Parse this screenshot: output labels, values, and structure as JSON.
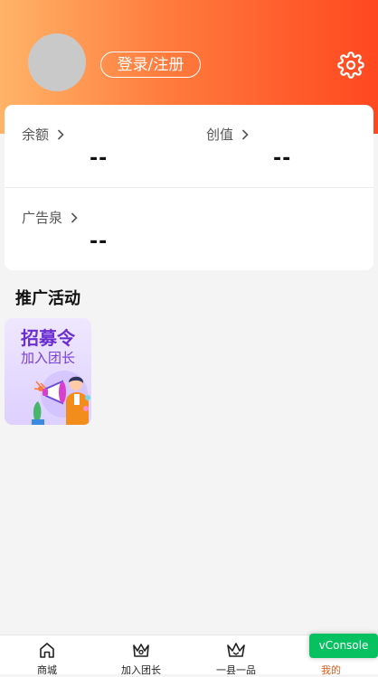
{
  "profile": {
    "login_label": "登录/注册"
  },
  "stats": {
    "balance": {
      "label": "余额",
      "value": "--"
    },
    "creation": {
      "label": "创值",
      "value": "--"
    },
    "ad_voucher": {
      "label": "广告泉",
      "value": "--"
    }
  },
  "promotions": {
    "title": "推广活动",
    "banner": {
      "line1": "招募令",
      "line2": "加入团长"
    }
  },
  "tabbar": {
    "items": [
      {
        "label": "商城",
        "icon": "home-icon"
      },
      {
        "label": "加入团长",
        "icon": "crown-icon"
      },
      {
        "label": "一县一品",
        "icon": "crown-outline-icon"
      },
      {
        "label": "我的",
        "icon": "user-icon",
        "active": true
      }
    ]
  },
  "vconsole": {
    "label": "vConsole"
  },
  "colors": {
    "header_start": "#ffb468",
    "header_end": "#ff4820",
    "active_tab": "#e25a1a",
    "vconsole_bg": "#07c160"
  }
}
